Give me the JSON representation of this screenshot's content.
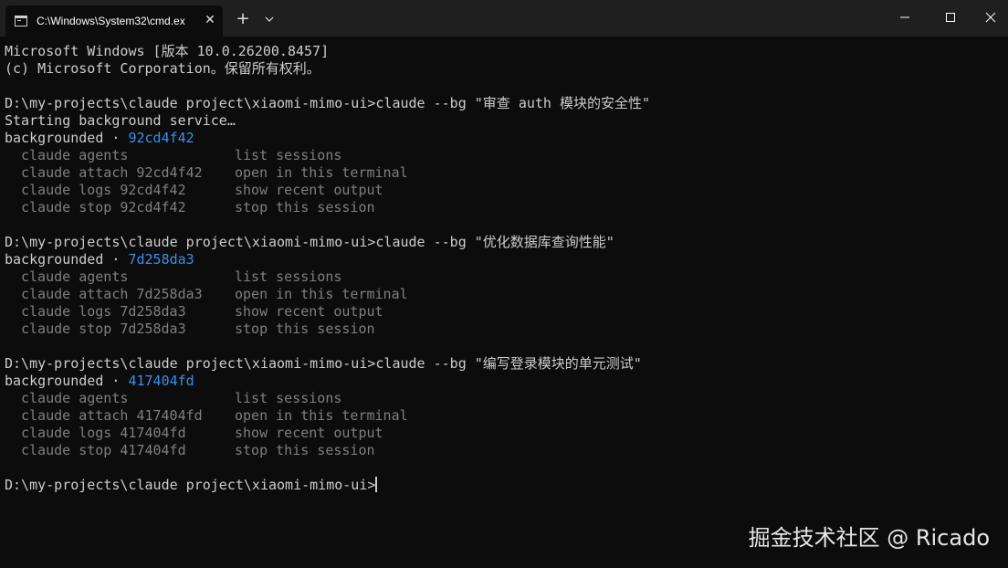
{
  "window": {
    "tab_title": "C:\\Windows\\System32\\cmd.ex",
    "tab_close_glyph": "✕",
    "new_tab_glyph": "+"
  },
  "terminal": {
    "header": [
      "Microsoft Windows [版本 10.0.26200.8457]",
      "(c) Microsoft Corporation。保留所有权利。"
    ],
    "sessions": [
      {
        "command": "D:\\my-projects\\claude project\\xiaomi-mimo-ui>claude --bg \"审查 auth 模块的安全性\"",
        "starting": "Starting background service…",
        "bg_label": "backgrounded · ",
        "id": "92cd4f42",
        "hints": [
          {
            "cmd": "claude agents",
            "desc": "list sessions"
          },
          {
            "cmd": "claude attach 92cd4f42",
            "desc": "open in this terminal"
          },
          {
            "cmd": "claude logs 92cd4f42",
            "desc": "show recent output"
          },
          {
            "cmd": "claude stop 92cd4f42",
            "desc": "stop this session"
          }
        ]
      },
      {
        "command": "D:\\my-projects\\claude project\\xiaomi-mimo-ui>claude --bg \"优化数据库查询性能\"",
        "bg_label": "backgrounded · ",
        "id": "7d258da3",
        "hints": [
          {
            "cmd": "claude agents",
            "desc": "list sessions"
          },
          {
            "cmd": "claude attach 7d258da3",
            "desc": "open in this terminal"
          },
          {
            "cmd": "claude logs 7d258da3",
            "desc": "show recent output"
          },
          {
            "cmd": "claude stop 7d258da3",
            "desc": "stop this session"
          }
        ]
      },
      {
        "command": "D:\\my-projects\\claude project\\xiaomi-mimo-ui>claude --bg \"编写登录模块的单元测试\"",
        "bg_label": "backgrounded · ",
        "id": "417404fd",
        "hints": [
          {
            "cmd": "claude agents",
            "desc": "list sessions"
          },
          {
            "cmd": "claude attach 417404fd",
            "desc": "open in this terminal"
          },
          {
            "cmd": "claude logs 417404fd",
            "desc": "show recent output"
          },
          {
            "cmd": "claude stop 417404fd",
            "desc": "stop this session"
          }
        ]
      }
    ],
    "prompt": "D:\\my-projects\\claude project\\xiaomi-mimo-ui>"
  },
  "watermark": "掘金技术社区 @ Ricado",
  "colors": {
    "background": "#0c0c0c",
    "titlebar": "#1f1f1f",
    "text": "#cccccc",
    "dim_text": "#7f7f7f",
    "session_id": "#3b8eea"
  }
}
